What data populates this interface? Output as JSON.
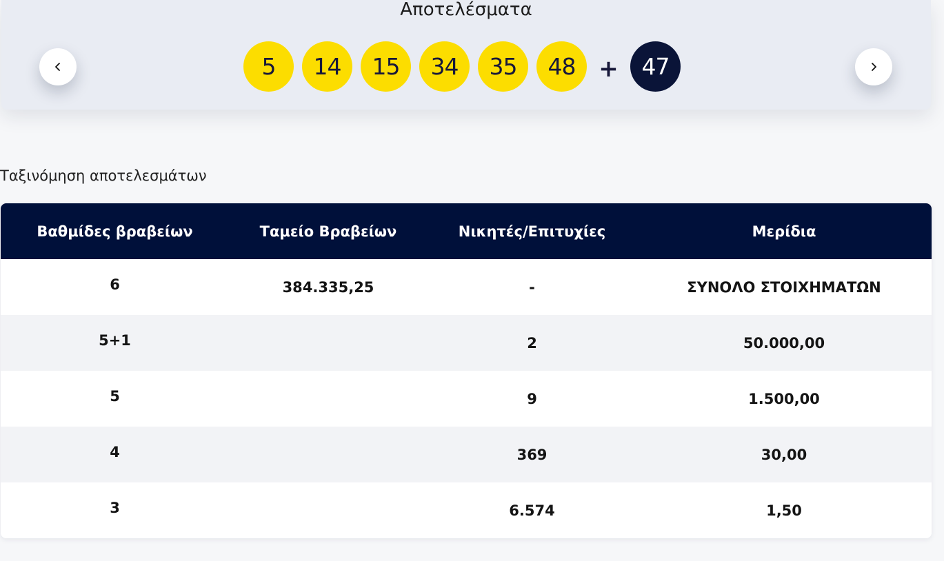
{
  "results": {
    "title": "Αποτελέσματα",
    "main_numbers": [
      "5",
      "14",
      "15",
      "34",
      "35",
      "48"
    ],
    "plus": "+",
    "bonus_number": "47",
    "prev_icon": "chevron-left-icon",
    "next_icon": "chevron-right-icon"
  },
  "sort_label": "Ταξινόμηση αποτελεσμάτων",
  "table": {
    "headers": [
      "Βαθμίδες βραβείων",
      "Ταμείο Βραβείων",
      "Νικητές/Επιτυχίες",
      "Μερίδια"
    ],
    "rows": [
      {
        "tier": "6",
        "fund": "384.335,25",
        "winners": "-",
        "share": "ΣΥΝΟΛΟ ΣΤΟΙΧΗΜΑΤΩΝ"
      },
      {
        "tier": "5+1",
        "fund": "",
        "winners": "2",
        "share": "50.000,00"
      },
      {
        "tier": "5",
        "fund": "",
        "winners": "9",
        "share": "1.500,00"
      },
      {
        "tier": "4",
        "fund": "",
        "winners": "369",
        "share": "30,00"
      },
      {
        "tier": "3",
        "fund": "",
        "winners": "6.574",
        "share": "1,50"
      }
    ]
  },
  "colors": {
    "ball_main": "#fcdd00",
    "ball_bonus": "#0a1438",
    "table_header": "#00103a"
  }
}
